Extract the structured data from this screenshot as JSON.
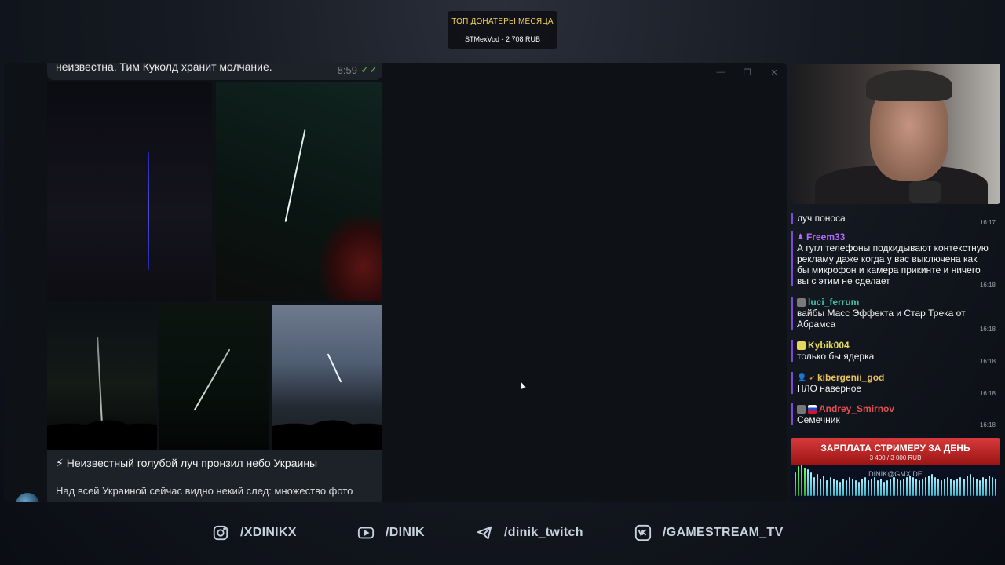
{
  "donators": {
    "title": "ТОП ДОНАТЕРЫ МЕСЯЦА",
    "value": "STMexVod - 2 708 RUB"
  },
  "telegram": {
    "window_controls": [
      "—",
      "❐",
      "✕"
    ],
    "prev_message": {
      "text": "неизвестна, Тим Куколд хранит молчание.",
      "time": "8:59",
      "status_icon": "double-check-icon"
    },
    "caption_title": "⚡ Неизвестный голубой луч пронзил небо Украины",
    "caption_body": "Над всей Украиной сейчас видно некий след: множество фото"
  },
  "chat": {
    "messages": [
      {
        "user": "",
        "text": "луч поноса",
        "time": "16:17"
      },
      {
        "user": "Freem33",
        "color": "#b06cff",
        "text": "А гугл телефоны подкидывают контекстную рекламу даже когда у вас выключена как бы микрофон и камера прикинте и ничего вы с этим не сделает",
        "time": "16:18"
      },
      {
        "user": "luci_ferrum",
        "color": "#3fc3a8",
        "text": "вайбы Масс Эффекта и Стар Трека от Абрамса",
        "time": "16:18"
      },
      {
        "user": "Kybik004",
        "color": "#e3d95a",
        "text": "только бы ядерка",
        "time": "16:18"
      },
      {
        "user": "kibergenii_god",
        "color": "#e9c35b",
        "text": "НЛО наверное",
        "time": "16:18"
      },
      {
        "user": "Andrey_Smirnov",
        "color": "#e05050",
        "text": "Семечник",
        "time": "16:18"
      }
    ]
  },
  "salary": {
    "title": "ЗАРПЛАТА СТРИМЕРУ ЗА ДЕНЬ",
    "value": "3 400 / 3 000 RUB",
    "email": "DINIK@GMX.DE"
  },
  "socials": [
    {
      "icon": "instagram-icon",
      "label": "/XDINIKX"
    },
    {
      "icon": "youtube-icon",
      "label": "/DINIK"
    },
    {
      "icon": "telegram-icon",
      "label": "/dinik_twitch"
    },
    {
      "icon": "vk-icon",
      "label": "/GAMESTREAM_TV"
    }
  ]
}
